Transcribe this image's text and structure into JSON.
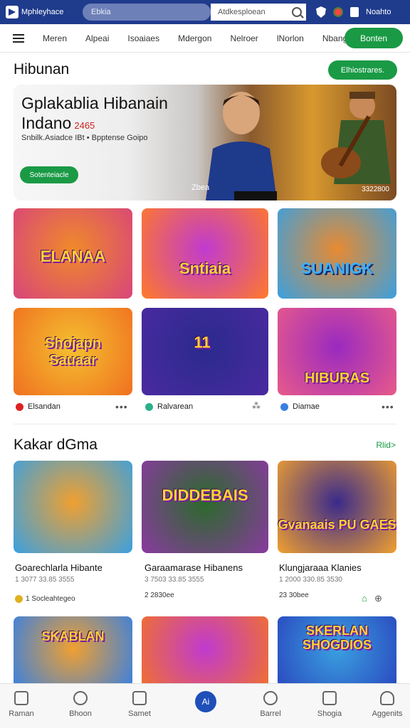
{
  "topbar": {
    "logo_text": "Mphleyhace",
    "address": "Ebkia",
    "search_placeholder": "Atdkesploean",
    "user_label": "Noahto"
  },
  "nav": {
    "items": [
      "Meren",
      "Alpeai",
      "Isoaiaes",
      "Mdergon",
      "Nelroer",
      "lNorlon",
      "Nbangee"
    ],
    "cta": "Bonten"
  },
  "section1": {
    "title": "Hibunan",
    "button": "Elhiostrares."
  },
  "hero": {
    "title_line1": "Gplakablia Hibanain",
    "title_line2": "Indano",
    "badge": "2465",
    "subtitle": "Snbilk.Asiadce IBt • Bpptense Goipo",
    "button": "Sotenteiacle",
    "tag": "Zbea",
    "meta": "3322800"
  },
  "tiles": [
    {
      "label": "ELANAA",
      "colors": [
        "#f08a2a",
        "#d8457a"
      ]
    },
    {
      "label": "Sntiaia",
      "colors": [
        "#c03ad0",
        "#ff7a2a"
      ]
    },
    {
      "label": "SUANIGK",
      "colors": [
        "#e88a30",
        "#3aa0e0"
      ]
    },
    {
      "label": "Shojapn Sauaar",
      "colors": [
        "#f4c030",
        "#f07020"
      ]
    },
    {
      "label": "11",
      "colors": [
        "#2a2a8c",
        "#4a2aa0"
      ]
    },
    {
      "label": "HIBURAS",
      "colors": [
        "#9a2ac0",
        "#e85a8a"
      ]
    }
  ],
  "tile_meta": [
    {
      "label": "Elsandan",
      "color": "#d22"
    },
    {
      "label": "Ralvarean",
      "color": "#2ab08a"
    },
    {
      "label": "Diamae",
      "color": "#3a80e0"
    }
  ],
  "section2": {
    "title": "Kakar dGma",
    "more": "Rlid>"
  },
  "cards": [
    {
      "label": "",
      "title": "Goarechlarla Hibante",
      "sub": "1 3077 33.85 3555",
      "meta": "1 Socleahtegeo",
      "colors": [
        "#f0a030",
        "#3aa0e0"
      ]
    },
    {
      "label": "DIDDEBAIS",
      "title": "Garaamarase Hibanens",
      "sub": "3 7503 33.85 3555",
      "meta": "2 2830ee",
      "colors": [
        "#2a6a2a",
        "#8a3aa0"
      ]
    },
    {
      "label": "Gvanaais PU GAES",
      "title": "Klungjaraaa Klanies",
      "sub": "1 2000 330.85 3530",
      "meta": "23 30bee",
      "colors": [
        "#3a2a8c",
        "#f0a030"
      ]
    }
  ],
  "row3": [
    {
      "label": "SKABLAN",
      "colors": [
        "#f0a030",
        "#3a80e0"
      ]
    },
    {
      "label": "",
      "colors": [
        "#c03ad0",
        "#f07030"
      ]
    },
    {
      "label": "SKERLAN SHOGDIOS",
      "colors": [
        "#3aa0e0",
        "#2a4ac0"
      ]
    }
  ],
  "bottom": {
    "items": [
      "Raman",
      "Bhoon",
      "Samet",
      "",
      "Barrel",
      "Shogia",
      "Aggenits"
    ],
    "center": "Ai"
  }
}
